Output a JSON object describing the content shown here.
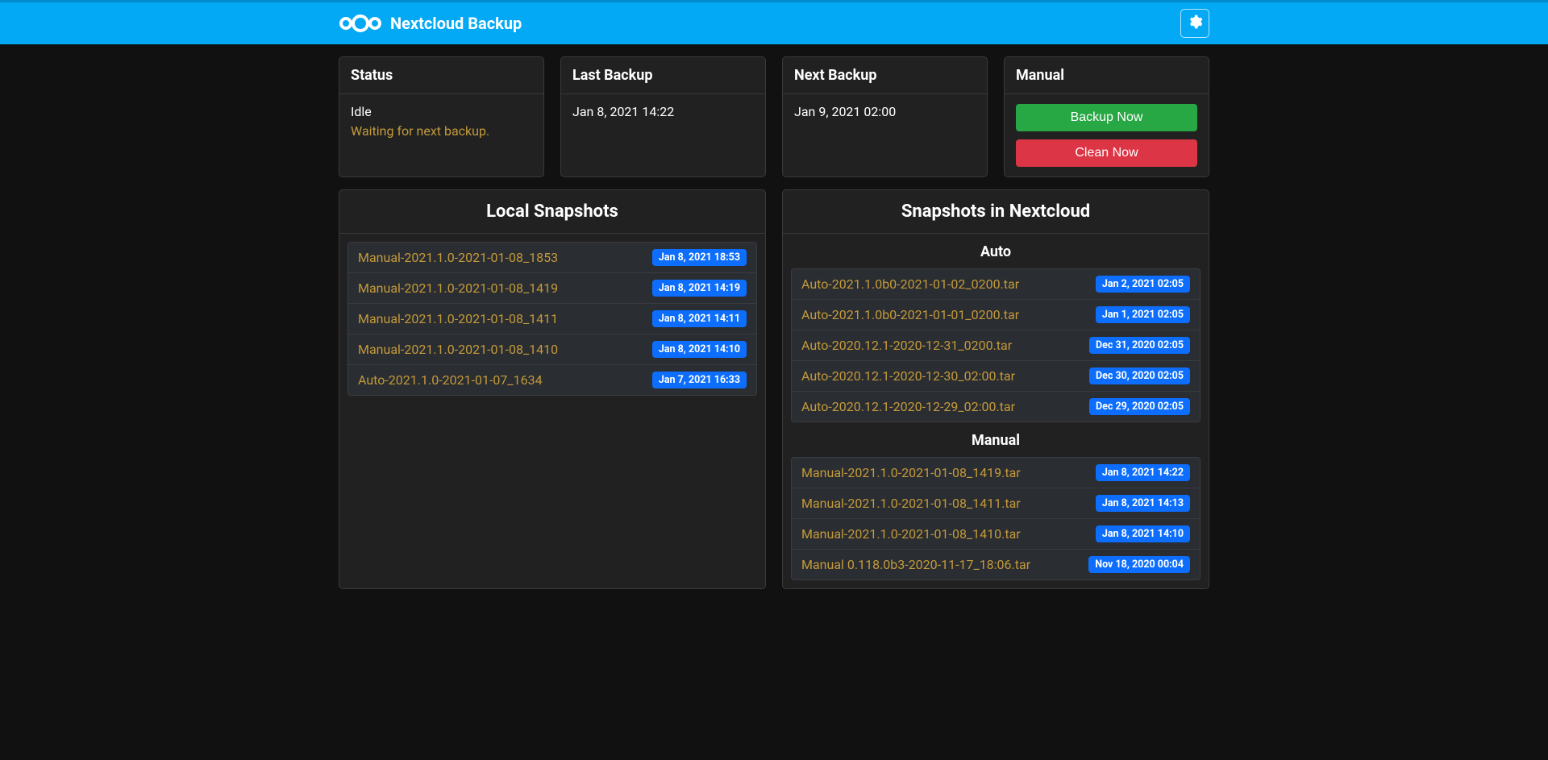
{
  "app": {
    "title": "Nextcloud Backup"
  },
  "status": {
    "heading": "Status",
    "value": "Idle",
    "message": "Waiting for next backup."
  },
  "last_backup": {
    "heading": "Last Backup",
    "value": "Jan 8, 2021 14:22"
  },
  "next_backup": {
    "heading": "Next Backup",
    "value": "Jan 9, 2021 02:00"
  },
  "manual": {
    "heading": "Manual",
    "backup_label": "Backup Now",
    "clean_label": "Clean Now"
  },
  "local_snapshots": {
    "title": "Local Snapshots",
    "items": [
      {
        "name": "Manual-2021.1.0-2021-01-08_1853",
        "date": "Jan 8, 2021 18:53"
      },
      {
        "name": "Manual-2021.1.0-2021-01-08_1419",
        "date": "Jan 8, 2021 14:19"
      },
      {
        "name": "Manual-2021.1.0-2021-01-08_1411",
        "date": "Jan 8, 2021 14:11"
      },
      {
        "name": "Manual-2021.1.0-2021-01-08_1410",
        "date": "Jan 8, 2021 14:10"
      },
      {
        "name": "Auto-2021.1.0-2021-01-07_1634",
        "date": "Jan 7, 2021 16:33"
      }
    ]
  },
  "nextcloud_snapshots": {
    "title": "Snapshots in Nextcloud",
    "auto_title": "Auto",
    "manual_title": "Manual",
    "auto": [
      {
        "name": "Auto-2021.1.0b0-2021-01-02_0200.tar",
        "date": "Jan 2, 2021 02:05"
      },
      {
        "name": "Auto-2021.1.0b0-2021-01-01_0200.tar",
        "date": "Jan 1, 2021 02:05"
      },
      {
        "name": "Auto-2020.12.1-2020-12-31_0200.tar",
        "date": "Dec 31, 2020 02:05"
      },
      {
        "name": "Auto-2020.12.1-2020-12-30_02:00.tar",
        "date": "Dec 30, 2020 02:05"
      },
      {
        "name": "Auto-2020.12.1-2020-12-29_02:00.tar",
        "date": "Dec 29, 2020 02:05"
      }
    ],
    "manual": [
      {
        "name": "Manual-2021.1.0-2021-01-08_1419.tar",
        "date": "Jan 8, 2021 14:22"
      },
      {
        "name": "Manual-2021.1.0-2021-01-08_1411.tar",
        "date": "Jan 8, 2021 14:13"
      },
      {
        "name": "Manual-2021.1.0-2021-01-08_1410.tar",
        "date": "Jan 8, 2021 14:10"
      },
      {
        "name": "Manual 0.118.0b3-2020-11-17_18:06.tar",
        "date": "Nov 18, 2020 00:04"
      }
    ]
  }
}
